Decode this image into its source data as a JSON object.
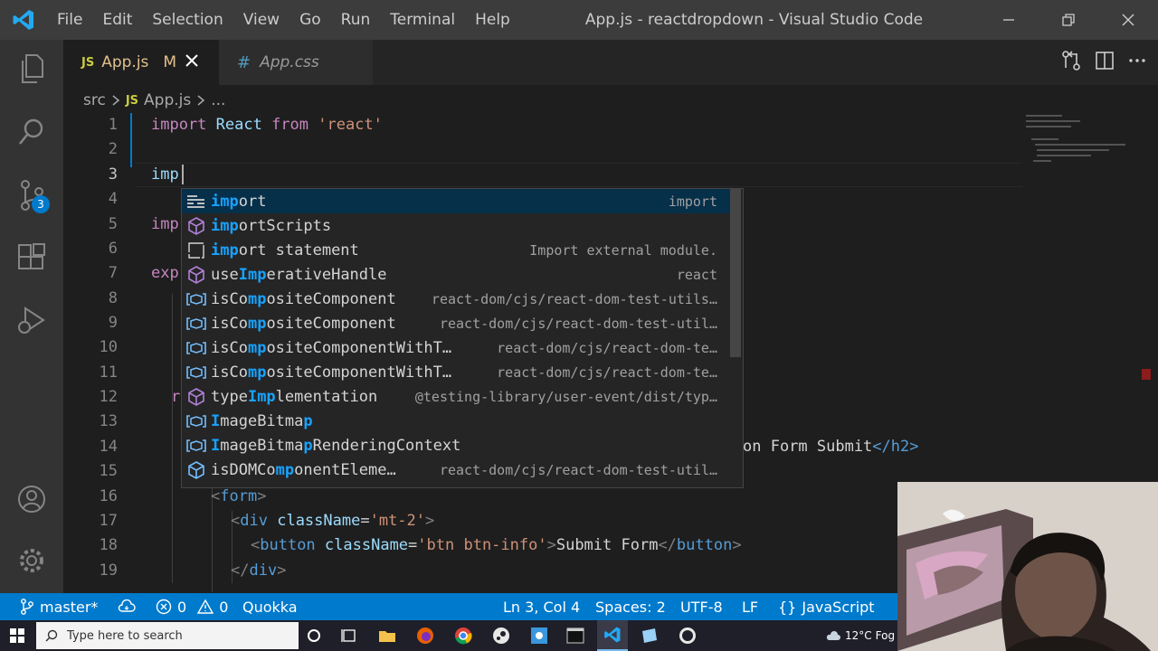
{
  "titlebar": {
    "menu": [
      "File",
      "Edit",
      "Selection",
      "View",
      "Go",
      "Run",
      "Terminal",
      "Help"
    ],
    "title": "App.js - reactdropdown - Visual Studio Code"
  },
  "activity": {
    "scm_badge": "3"
  },
  "tabs": [
    {
      "icon": "JS",
      "label": "App.js",
      "modified": "M"
    },
    {
      "icon": "#",
      "label": "App.css"
    }
  ],
  "breadcrumb": {
    "folder": "src",
    "file_icon": "JS",
    "file": "App.js",
    "more": "..."
  },
  "editor": {
    "line_numbers": [
      "1",
      "2",
      "3",
      "4",
      "5",
      "6",
      "7",
      "8",
      "9",
      "10",
      "11",
      "12",
      "13",
      "14",
      "15",
      "16",
      "17",
      "18",
      "19"
    ],
    "partial": {
      "l5": "imp",
      "l7": "exp",
      "l12": "r",
      "l14": "on Form Submit",
      "l14_close": "</h2>"
    },
    "lines": {
      "l1": {
        "import": "import",
        "name": " React ",
        "from": "from",
        "module": " 'react'"
      },
      "l3": "imp",
      "l16": {
        "open": "<",
        "tag": "form",
        "close": ">"
      },
      "l17": {
        "tag": "div",
        "attr": "className",
        "value": "'mt-2'"
      },
      "l18": {
        "tag": "button",
        "attr": "className",
        "value": "'btn btn-info'",
        "text": "Submit Form",
        "endtag": "button"
      },
      "l19": {
        "endtag": "div"
      }
    }
  },
  "suggestions": [
    {
      "icon": "keyword",
      "match": "imp",
      "rest": "ort",
      "detail": "import"
    },
    {
      "icon": "module",
      "match": "imp",
      "rest": "ortScripts",
      "detail": ""
    },
    {
      "icon": "snippet",
      "match": "imp",
      "rest": "ort statement",
      "detail": "Import external module."
    },
    {
      "icon": "module",
      "pre": "use",
      "match": "Imp",
      "rest": "erativeHandle",
      "detail": "react"
    },
    {
      "icon": "variable",
      "pre": "isCo",
      "match": "mp",
      "rest": "ositeComponent",
      "detail": "react-dom/cjs/react-dom-test-utils…"
    },
    {
      "icon": "variable",
      "pre": "isCo",
      "match": "mp",
      "rest": "ositeComponent",
      "detail": "react-dom/cjs/react-dom-test-util…"
    },
    {
      "icon": "variable",
      "pre": "isCo",
      "match": "mp",
      "rest": "ositeComponentWithT…",
      "detail": "react-dom/cjs/react-dom-te…"
    },
    {
      "icon": "variable",
      "pre": "isCo",
      "match": "mp",
      "rest": "ositeComponentWithT…",
      "detail": "react-dom/cjs/react-dom-te…"
    },
    {
      "icon": "module",
      "pre": "type",
      "match": "Imp",
      "rest": "lementation",
      "detail": "@testing-library/user-event/dist/typ…"
    },
    {
      "icon": "variable",
      "pre": "",
      "match": "I",
      "mid": "mageBitma",
      "match2": "p",
      "rest": "",
      "detail": ""
    },
    {
      "icon": "variable",
      "pre": "",
      "match": "I",
      "mid": "mageBitma",
      "match2": "p",
      "rest": "RenderingContext",
      "detail": ""
    },
    {
      "icon": "interface",
      "pre": "isDOMCo",
      "match": "mp",
      "rest": "onentEleme…",
      "detail": "react-dom/cjs/react-dom-test-util…"
    }
  ],
  "statusbar": {
    "branch": "master*",
    "errors": "0",
    "warnings": "0",
    "quokka": "Quokka",
    "position": "Ln 3, Col 4",
    "spaces": "Spaces: 2",
    "encoding": "UTF-8",
    "eol": "LF",
    "language": "JavaScript",
    "lang_icon": "{}"
  },
  "taskbar": {
    "search_placeholder": "Type here to search",
    "weather": "12°C",
    "weather_text": "Fog"
  },
  "colors": {
    "accent": "#007acc",
    "match_highlight": "#18a3ff",
    "keyword": "#c586c0",
    "string": "#ce9178"
  }
}
